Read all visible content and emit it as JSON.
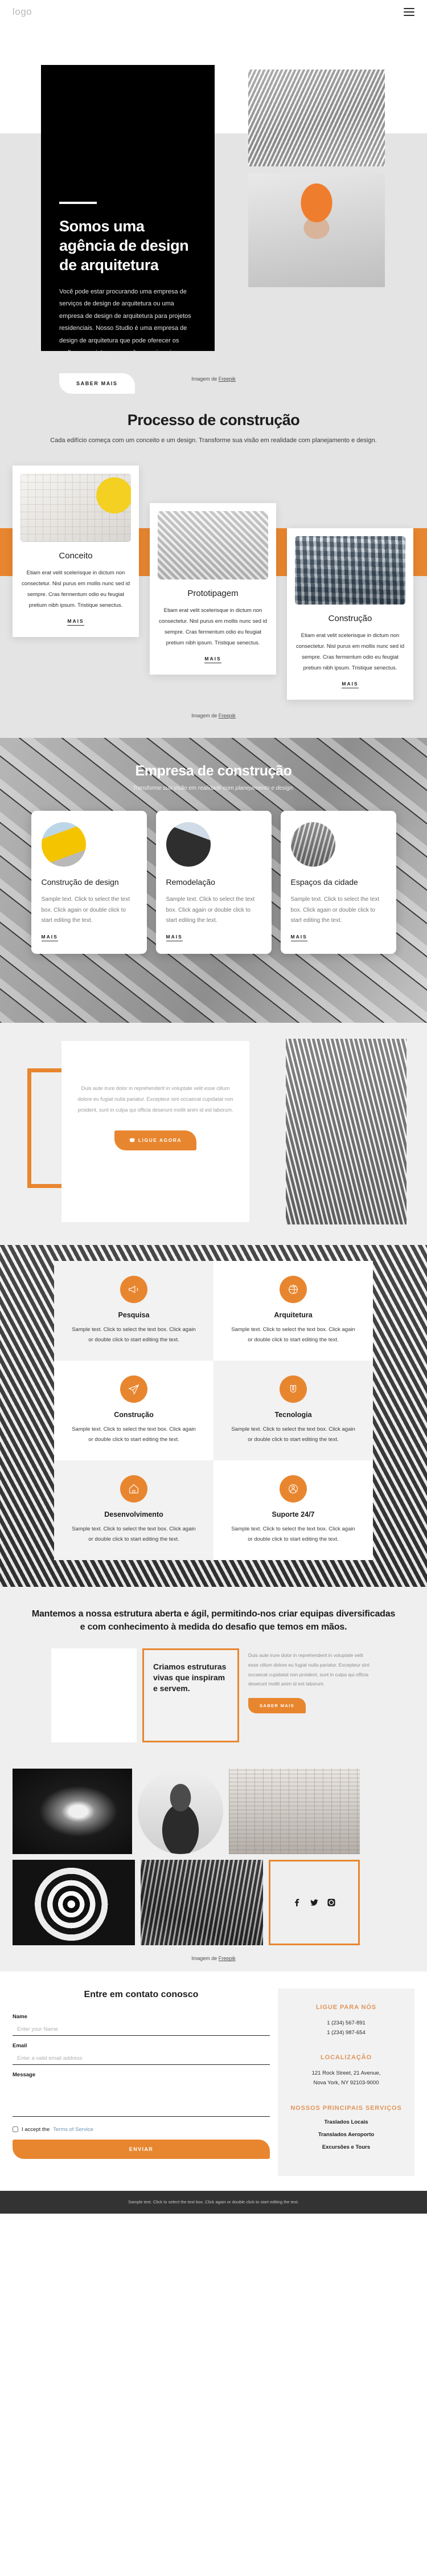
{
  "header": {
    "logo": "logo",
    "menu_icon": "hamburger-icon"
  },
  "hero": {
    "title": "Somos uma agência de design de arquitetura",
    "paragraph": "Você pode estar procurando uma empresa de serviços de design de arquitetura ou uma empresa de design de arquitetura para projetos residenciais. Nosso Studio é uma empresa de design de arquitetura que pode oferecer os melhores projetos que você possa imaginar.",
    "button": "SABER MAIS",
    "credit_prefix": "Imagem de ",
    "credit_link": "Freepik"
  },
  "process": {
    "title": "Processo de construção",
    "subtitle": "Cada edifício começa com um conceito e um design. Transforme sua visão em realidade com planejamento e design.",
    "more_label": "MAIS",
    "credit_prefix": "Imagem de ",
    "credit_link": "Freepik",
    "cards": [
      {
        "title": "Conceito",
        "text": "Etiam erat velit scelerisque in dictum non consectetur. Nisl purus em mollis nunc sed id sempre. Cras fermentum odio eu feugiat pretium nibh ipsum. Tristique senectus.",
        "image": "blueprint-hardhat-photo"
      },
      {
        "title": "Prototipagem",
        "text": "Etiam erat velit scelerisque in dictum non consectetur. Nisl purus em mollis nunc sed id sempre. Cras fermentum odio eu feugiat pretium nibh ipsum. Tristique senectus.",
        "image": "architecture-model-photo"
      },
      {
        "title": "Construção",
        "text": "Etiam erat velit scelerisque in dictum non consectetur. Nisl purus em mollis nunc sed id sempre. Cras fermentum odio eu feugiat pretium nibh ipsum. Tristique senectus.",
        "image": "glass-tower-photo"
      }
    ]
  },
  "empresa": {
    "title": "Empresa de construção",
    "subtitle": "Transforme sua visão em realidade com planejamento e design.",
    "more_label": "MAIS",
    "cards": [
      {
        "title": "Construção de design",
        "text": "Sample text. Click to select the text box. Click again or double click to start editing the text.",
        "image": "yellow-building-photo"
      },
      {
        "title": "Remodelação",
        "text": "Sample text. Click to select the text box. Click again or double click to start editing the text.",
        "image": "black-building-photo"
      },
      {
        "title": "Espaços da cidade",
        "text": "Sample text. Click to select the text box. Click again or double click to start editing the text.",
        "image": "city-space-photo"
      }
    ]
  },
  "cta": {
    "paragraph": "Duis aute irure dolor in reprehenderit in voluptate velit esse cillum dolore eu fugiat nulla pariatur. Excepteur sint occaecat cupidatat non proident, sunt in culpa qui officia deserunt mollit anim id est laborum.",
    "button": "LIGUE AGORA",
    "button_icon": "phone-icon"
  },
  "grid6": {
    "items": [
      {
        "title": "Pesquisa",
        "text": "Sample text. Click to select the text box. Click again or double click to start editing the text.",
        "icon": "megaphone-icon"
      },
      {
        "title": "Arquitetura",
        "text": "Sample text. Click to select the text box. Click again or double click to start editing the text.",
        "icon": "globe-icon"
      },
      {
        "title": "Construção",
        "text": "Sample text. Click to select the text box. Click again or double click to start editing the text.",
        "icon": "paper-plane-icon"
      },
      {
        "title": "Tecnologia",
        "text": "Sample text. Click to select the text box. Click again or double click to start editing the text.",
        "icon": "magnet-icon"
      },
      {
        "title": "Desenvolvimento",
        "text": "Sample text. Click to select the text box. Click again or double click to start editing the text.",
        "icon": "home-icon"
      },
      {
        "title": "Suporte 24/7",
        "text": "Sample text. Click to select the text box. Click again or double click to start editing the text.",
        "icon": "support-icon"
      }
    ]
  },
  "mantemos": {
    "heading": "Mantemos a nossa estrutura aberta e ágil, permitindo-nos criar equipas diversificadas e com conhecimento à medida do desafio que temos em mãos.",
    "box_title": "Criamos estruturas vivas que inspiram e servem.",
    "paragraph": "Duis aute irure dolor in reprehenderit in voluptate velit esse cillum dolore eu fugiat nulla pariatur. Excepteur sint occaecat cupidatat non proident, sunt in culpa qui officia deserunt mollit anim id est laborum.",
    "button": "SABER MAIS"
  },
  "gallery": {
    "credit_prefix": "Imagem de ",
    "credit_link": "Freepik",
    "social": [
      "facebook-icon",
      "twitter-icon",
      "instagram-icon"
    ]
  },
  "footer": {
    "form_title": "Entre em contato conosco",
    "fields": [
      {
        "label": "Name",
        "placeholder": "Enter your Name",
        "value": ""
      },
      {
        "label": "Email",
        "placeholder": "Enter a valid email address",
        "value": ""
      },
      {
        "label": "Message",
        "placeholder": "",
        "value": ""
      }
    ],
    "terms_prefix": "I accept the ",
    "terms_link": "Terms of Service",
    "submit": "ENVIAR",
    "call_title": "LIGUE PARA NÓS",
    "phones": [
      "1 (234) 567-891",
      "1 (234) 987-654"
    ],
    "location_title": "LOCALIZAÇÃO",
    "address_line1": "121 Rock Street, 21 Avenue,",
    "address_line2": "Nova York, NY 92103-9000",
    "services_title": "NOSSOS PRINCIPAIS SERVIÇOS",
    "services": [
      "Traslados Locais",
      "Translados Aeroporto",
      "Excursões e Tours"
    ],
    "bottom_text": "Sample text. Click to select the text box. Click again or double click to start editing the text."
  },
  "colors": {
    "accent": "#e8862f",
    "dark": "#000000",
    "muted": "#9d9d9d",
    "bar": "#333333"
  }
}
